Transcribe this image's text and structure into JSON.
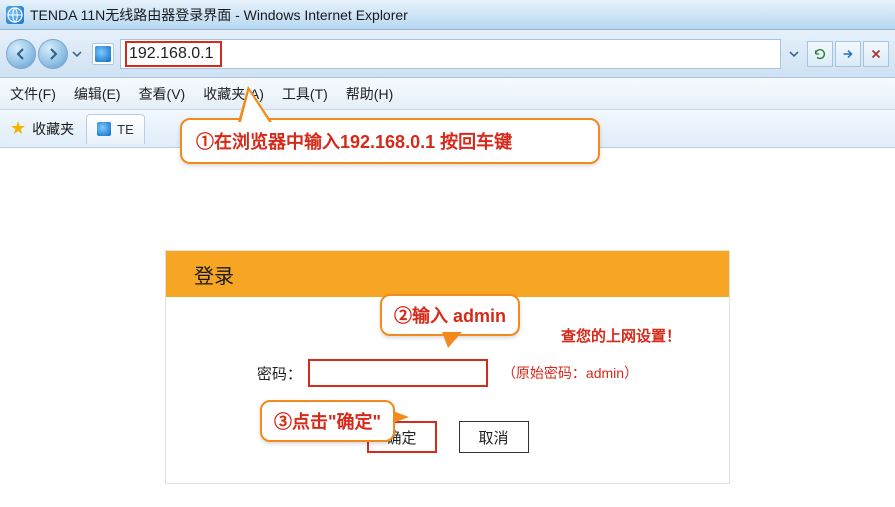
{
  "titlebar": {
    "title": "TENDA 11N无线路由器登录界面 - Windows Internet Explorer"
  },
  "address": {
    "url": "192.168.0.1"
  },
  "menubar": {
    "file": "文件(F)",
    "edit": "编辑(E)",
    "view": "查看(V)",
    "favorites": "收藏夹(A)",
    "tools": "工具(T)",
    "help": "帮助(H)"
  },
  "favrow": {
    "favorites_label": "收藏夹",
    "tab_label": "TE"
  },
  "callouts": {
    "c1": "①在浏览器中输入192.168.0.1 按回车键",
    "c2": "②输入 admin",
    "c3": "③点击\"确定\""
  },
  "login": {
    "header": "登录",
    "check_text": "查您的上网设置！",
    "pw_label": "密码：",
    "pw_note": "（原始密码：admin）",
    "ok": "确定",
    "cancel": "取消"
  }
}
